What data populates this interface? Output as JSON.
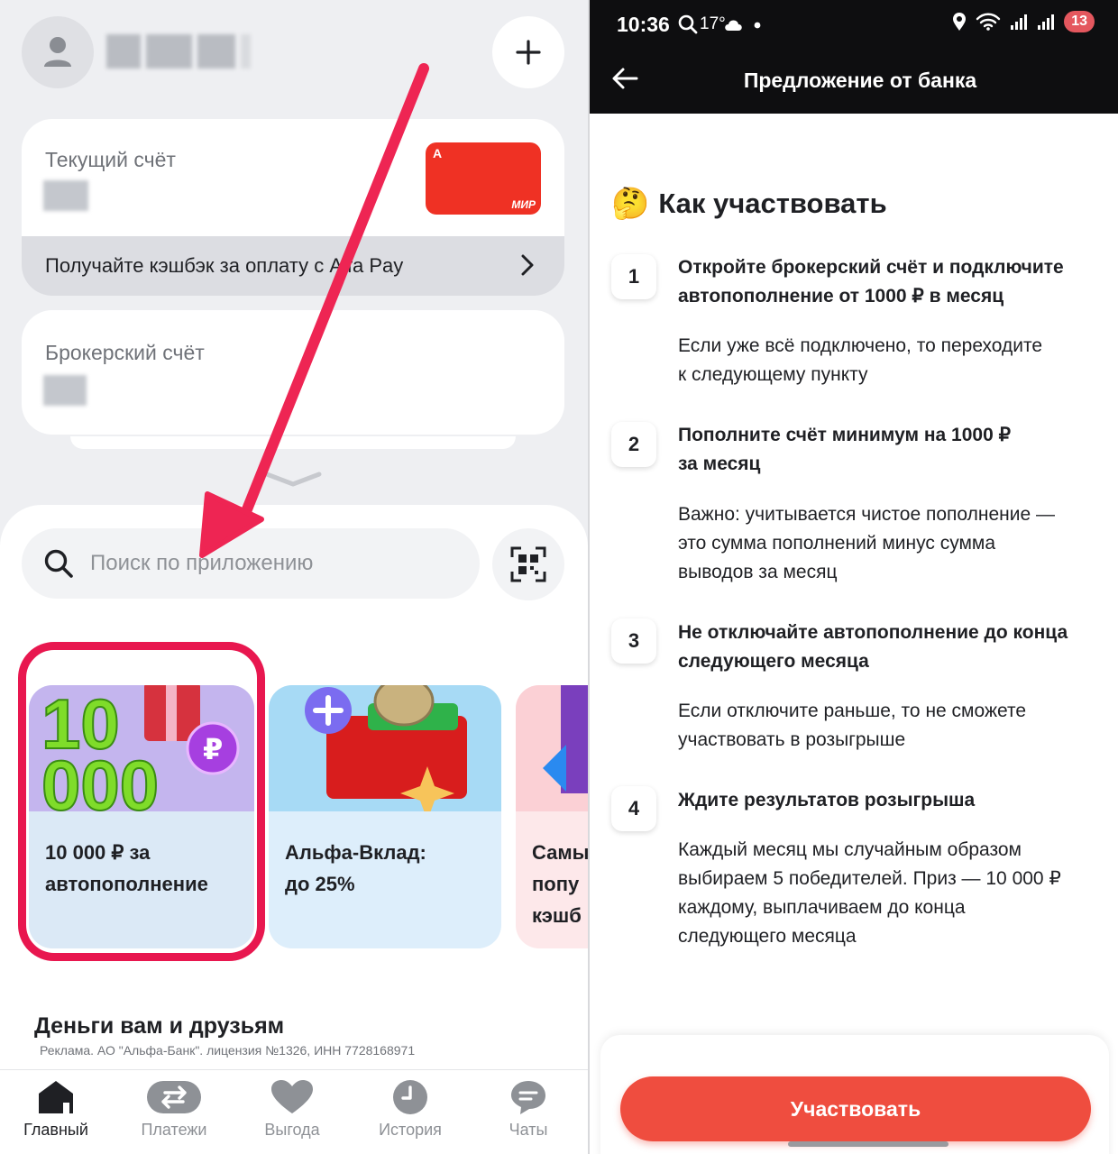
{
  "left": {
    "accounts": {
      "current": {
        "title": "Текущий счёт",
        "card_bank_letter": "А",
        "card_brand": "МИР"
      },
      "cashback_banner": "Получайте кэшбэк за оплату с Alfa Pay",
      "broker": {
        "title": "Брокерский счёт"
      }
    },
    "search": {
      "placeholder": "Поиск по приложению"
    },
    "promos": [
      {
        "label": "10 000 ₽ за\nавтопополнение",
        "art_text": "10 000"
      },
      {
        "label": "Альфа-Вклад:\nдо 25%"
      },
      {
        "label": "Самы\nпопу\nкэшб"
      }
    ],
    "section_title": "Деньги вам и друзьям",
    "ad_disclaimer": "Реклама. АО \"Альфа-Банк\". лицензия №1326, ИНН 7728168971",
    "tabs": [
      {
        "label": "Главный",
        "icon": "home-icon",
        "active": true
      },
      {
        "label": "Платежи",
        "icon": "transfer-icon"
      },
      {
        "label": "Выгода",
        "icon": "heart-icon"
      },
      {
        "label": "История",
        "icon": "clock-icon"
      },
      {
        "label": "Чаты",
        "icon": "chat-icon"
      }
    ]
  },
  "right": {
    "status": {
      "time": "10:36",
      "temp": "17°",
      "battery_badge": "13"
    },
    "appbar_title": "Предложение от банка",
    "how_title": "Как участвовать",
    "how_emoji": "🤔",
    "steps": [
      {
        "num": "1",
        "title": "Откройте брокерский счёт и подключите\nавтопополнение от 1000 ₽ в месяц",
        "body": "Если уже всё подключено, то переходите\nк следующему пункту"
      },
      {
        "num": "2",
        "title": "Пополните счёт минимум на 1000 ₽\nза месяц",
        "body": "Важно: учитывается чистое пополнение —\nэто сумма пополнений минус сумма\nвыводов за месяц"
      },
      {
        "num": "3",
        "title": "Не отключайте автопополнение до конца\nследующего месяца",
        "body": "Если отключите раньше, то не сможете\nучаствовать в розыгрыше"
      },
      {
        "num": "4",
        "title": "Ждите результатов розыгрыша",
        "body": "Каждый месяц мы случайным образом\nвыбираем 5 победителей. Приз — 10 000 ₽\nкаждому, выплачиваем до конца\nследующего месяца"
      }
    ],
    "cta_label": "Участвовать"
  },
  "colors": {
    "accent_red": "#ef3124",
    "highlight": "#e8174f",
    "cta": "#ef4d3f"
  }
}
